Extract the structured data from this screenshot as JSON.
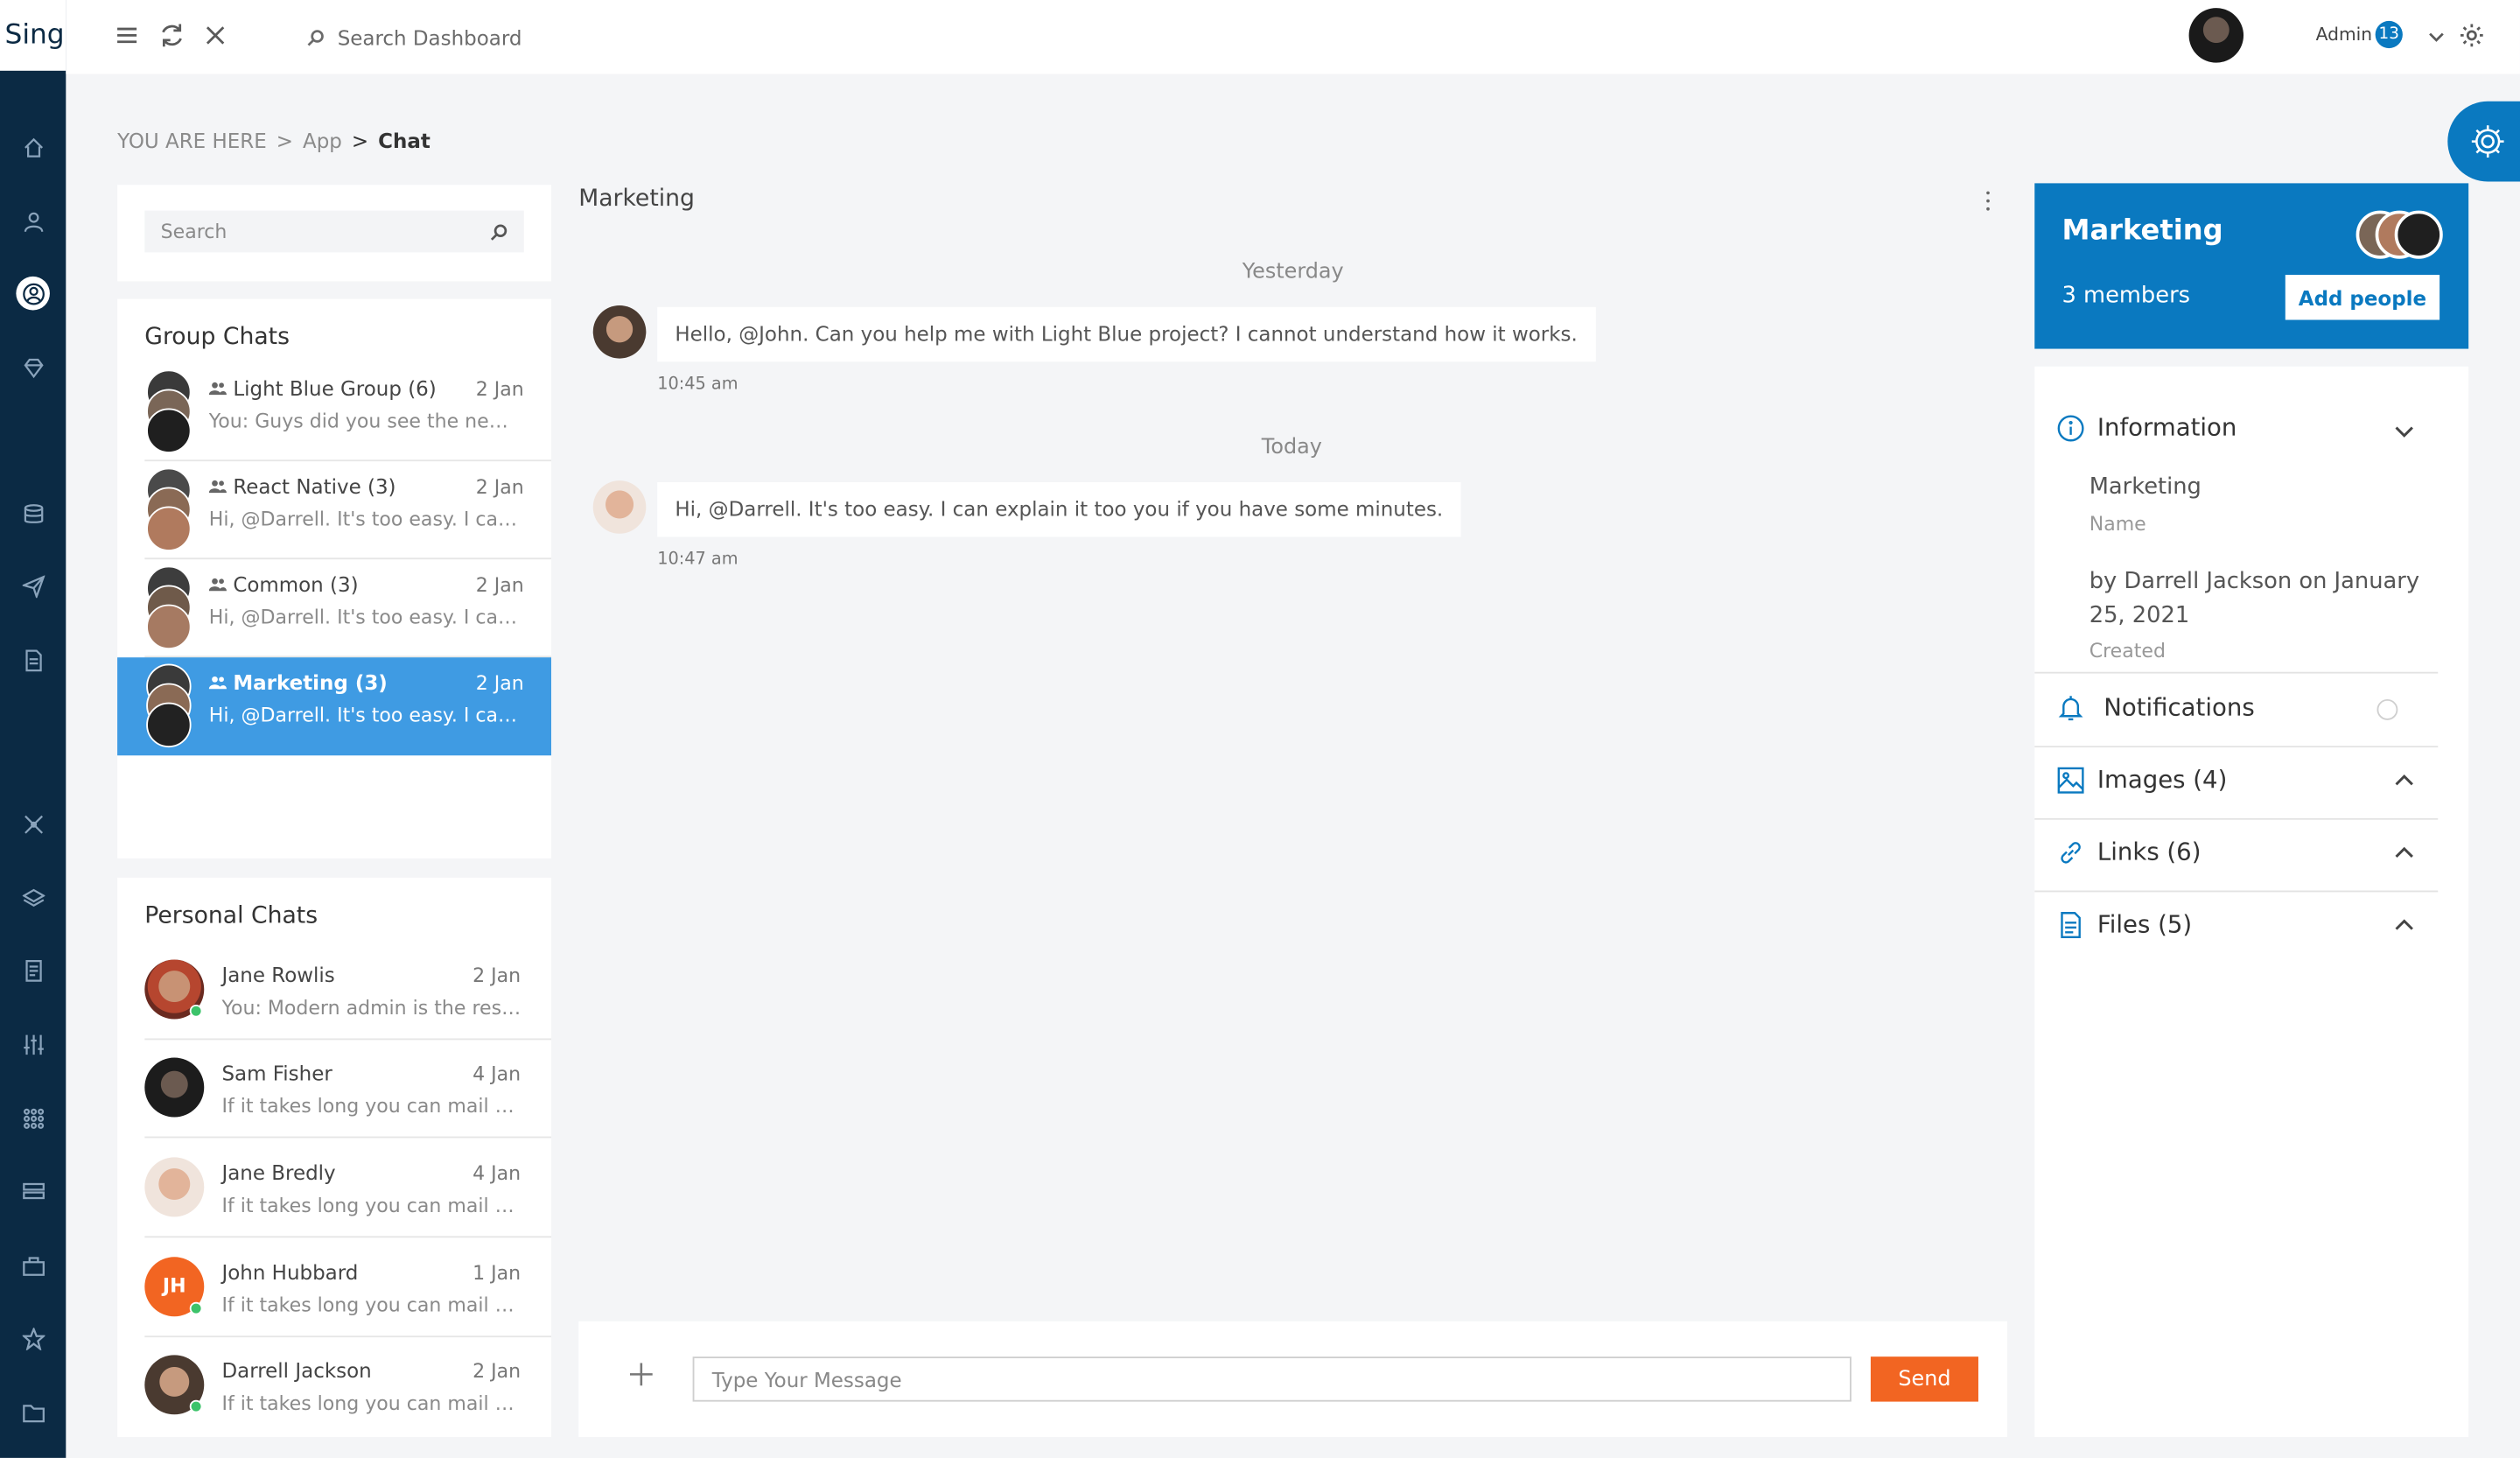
{
  "app": {
    "logo": "Sing"
  },
  "topbar": {
    "search_placeholder": "Search Dashboard",
    "user_label": "Admin",
    "notification_count": "13"
  },
  "breadcrumb": {
    "prefix": "YOU ARE HERE",
    "sep1": ">",
    "app": "App",
    "sep2": ">",
    "current": "Chat"
  },
  "left": {
    "search_placeholder": "Search",
    "group_title": "Group Chats",
    "groups": [
      {
        "name": "Light Blue Group (6)",
        "date": "2 Jan",
        "preview": "You:  Guys did you see the new update?"
      },
      {
        "name": "React Native (3)",
        "date": "2 Jan",
        "preview": "Hi, @Darrell. It's too easy. I can explain it too you"
      },
      {
        "name": "Common (3)",
        "date": "2 Jan",
        "preview": "Hi, @Darrell. It's too easy. I can explain it too you"
      },
      {
        "name": "Marketing (3)",
        "date": "2 Jan",
        "preview": "Hi, @Darrell. It's too easy. I can explain it too you"
      }
    ],
    "personal_title": "Personal Chats",
    "personal": [
      {
        "name": "Jane Rowlis",
        "date": "2 Jan",
        "preview": "You: Modern admin is the rest of the world",
        "online": true
      },
      {
        "name": "Sam Fisher",
        "date": "4 Jan",
        "preview": "If it takes long you can mail me at my mail",
        "online": false
      },
      {
        "name": "Jane Bredly",
        "date": "4 Jan",
        "preview": "If it takes long you can mail me at my mail",
        "online": false
      },
      {
        "name": "John Hubbard",
        "date": "1 Jan",
        "preview": "If it takes long you can mail me at my mail",
        "initials": "JH",
        "online": true
      },
      {
        "name": "Darrell Jackson",
        "date": "2 Jan",
        "preview": "If it takes long you can mail me at my mail",
        "online": true
      }
    ]
  },
  "chat": {
    "title": "Marketing",
    "days": [
      {
        "label": "Yesterday",
        "message": "Hello, @John. Can you help me with Light Blue project? I cannot understand how it works.",
        "time": "10:45 am"
      },
      {
        "label": "Today",
        "message": "Hi, @Darrell. It's too easy. I can explain it too you if you have some minutes.",
        "time": "10:47 am"
      }
    ],
    "input_placeholder": "Type Your Message",
    "send_label": "Send"
  },
  "right": {
    "group_name": "Marketing",
    "members": "3 members",
    "add_people": "Add people",
    "information_label": "Information",
    "name_value": "Marketing",
    "name_label": "Name",
    "created_value": "by Darrell Jackson on January 25, 2021",
    "created_label": "Created",
    "notifications_label": "Notifications",
    "images_label": "Images (4)",
    "links_label": "Links (6)",
    "files_label": "Files (5)"
  },
  "colors": {
    "primary": "#0a79c0",
    "active_row": "#3f9be3",
    "sidebar": "#0b2a44",
    "send": "#f26522",
    "online": "#3cc36a"
  }
}
